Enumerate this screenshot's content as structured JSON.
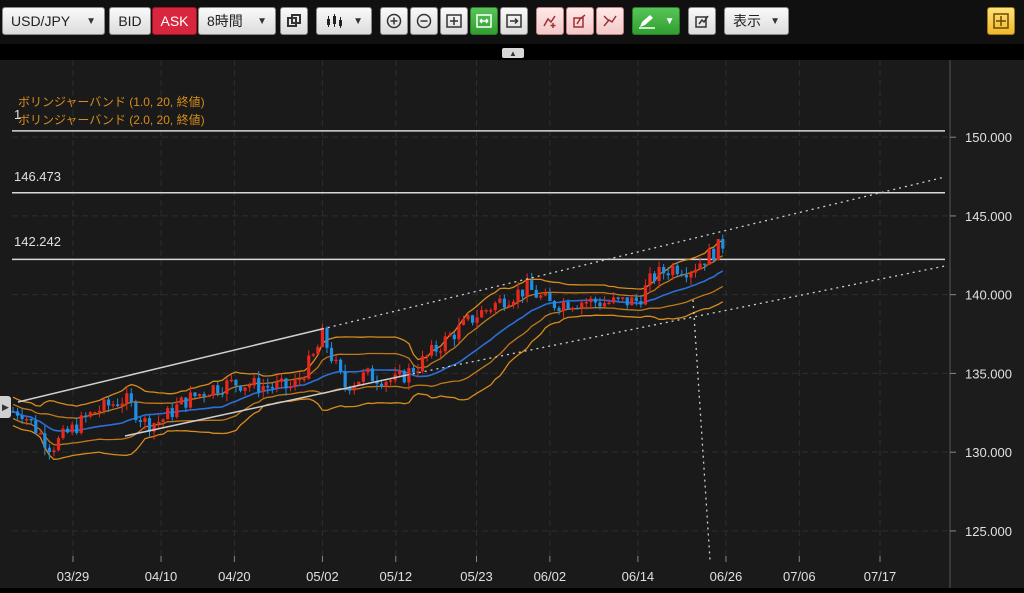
{
  "toolbar": {
    "pair": "USD/JPY",
    "bid_label": "BID",
    "ask_label": "ASK",
    "timeframe": "8時間",
    "display_label": "表示"
  },
  "colors": {
    "ask": "#d7263d",
    "candle_up": "#e8281e",
    "candle_down": "#1f8fe6",
    "bb1": "#c0781a",
    "bb2": "#d88c1a",
    "ma": "#2b6fd6",
    "lines": "#d8d8d8"
  },
  "indicators": {
    "bb1_label": "ボリンジャーバンド (1.0, 20, 終値)",
    "bb2_label": "ボリンジャーバンド (2.0, 20, 終値)"
  },
  "hlines": {
    "top_label": "1",
    "mid_label": "146.473",
    "low_label": "142.242"
  },
  "chart_data": {
    "type": "candlestick",
    "x_tick_labels": [
      "03/29",
      "04/10",
      "04/20",
      "05/02",
      "05/12",
      "05/23",
      "06/02",
      "06/14",
      "06/26",
      "07/06",
      "07/17"
    ],
    "y_tick_labels": [
      "150.000",
      "145.000",
      "140.000",
      "135.000",
      "130.000",
      "125.000"
    ],
    "ylim": [
      122.9,
      156.0
    ],
    "horizontal_lines": [
      150.4,
      146.473,
      142.242
    ],
    "price_path": [
      {
        "x": "03/22",
        "y": 132.6
      },
      {
        "x": "03/26",
        "y": 130.3
      },
      {
        "x": "03/29",
        "y": 131.5
      },
      {
        "x": "04/01",
        "y": 132.6
      },
      {
        "x": "04/05",
        "y": 133.4
      },
      {
        "x": "04/08",
        "y": 131.8
      },
      {
        "x": "04/10",
        "y": 132.0
      },
      {
        "x": "04/13",
        "y": 133.2
      },
      {
        "x": "04/17",
        "y": 134.1
      },
      {
        "x": "04/20",
        "y": 134.4
      },
      {
        "x": "04/24",
        "y": 134.2
      },
      {
        "x": "04/28",
        "y": 134.1
      },
      {
        "x": "05/01",
        "y": 136.2
      },
      {
        "x": "05/02",
        "y": 137.4
      },
      {
        "x": "05/05",
        "y": 134.2
      },
      {
        "x": "05/08",
        "y": 134.9
      },
      {
        "x": "05/12",
        "y": 134.5
      },
      {
        "x": "05/15",
        "y": 135.5
      },
      {
        "x": "05/19",
        "y": 137.2
      },
      {
        "x": "05/23",
        "y": 138.7
      },
      {
        "x": "05/27",
        "y": 139.8
      },
      {
        "x": "05/30",
        "y": 140.4
      },
      {
        "x": "06/02",
        "y": 139.4
      },
      {
        "x": "06/06",
        "y": 139.6
      },
      {
        "x": "06/10",
        "y": 139.5
      },
      {
        "x": "06/14",
        "y": 139.6
      },
      {
        "x": "06/16",
        "y": 141.1
      },
      {
        "x": "06/19",
        "y": 141.8
      },
      {
        "x": "06/21",
        "y": 141.6
      },
      {
        "x": "06/24",
        "y": 142.6
      },
      {
        "x": "06/26",
        "y": 143.4
      }
    ]
  }
}
